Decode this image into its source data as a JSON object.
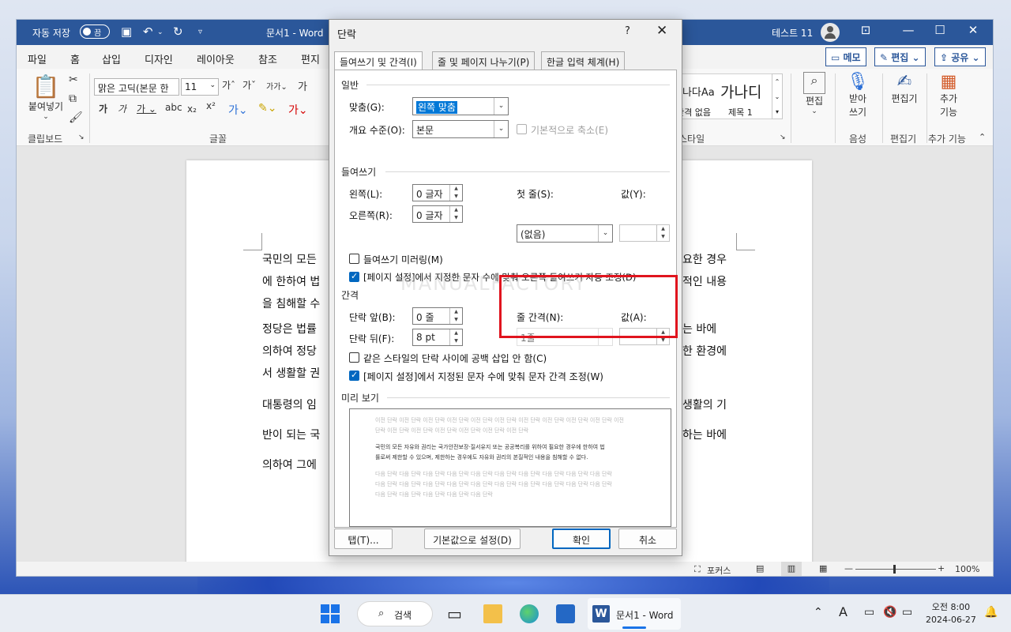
{
  "word": {
    "titlebar": {
      "autosave_label": "자동 저장",
      "autosave_state": "끔",
      "doc_title": "문서1 - Word",
      "user": "테스트 11"
    },
    "tabs": [
      "파일",
      "홈",
      "삽입",
      "디자인",
      "레이아웃",
      "참조",
      "편지"
    ],
    "active_tab": "홈",
    "right_buttons": {
      "memo": "메모",
      "edit": "편집",
      "share": "공유"
    },
    "ribbon": {
      "paste": "붙여넣기",
      "clipboard": "클립보드",
      "font_name": "맑은 고딕(본문 한",
      "font_size": "11",
      "font_group": "글꼴",
      "style_preview_1": "가나다Aa",
      "style_preview_2": "가나디",
      "style_name_1": "간격 없음",
      "style_name_2": "제목 1",
      "style_group": "스타일",
      "editing": "편집",
      "dictate_1": "받아",
      "dictate_2": "쓰기",
      "voice_group": "음성",
      "editor": "편집기",
      "editor_group": "편집기",
      "addins_1": "추가",
      "addins_2": "기능",
      "addins_group": "추가 기능"
    },
    "document": {
      "lines": [
        "국민의 모든",
        "에 한하여 법",
        "을 침해할 수",
        "정당은 법률",
        "의하여 정당",
        "서 생활할 권",
        "대통령의 임",
        "반이 되는 국",
        "의하여 그에"
      ],
      "right_fragments": [
        "요한 경우",
        "적인 내용",
        "",
        "는 바에",
        "한 환경에",
        "",
        "생활의 기",
        "하는 바에",
        ""
      ]
    },
    "status": {
      "focus": "포커스",
      "zoom": "100%"
    }
  },
  "dialog": {
    "title": "단락",
    "help": "?",
    "tabs": [
      "들여쓰기 및 간격(I)",
      "줄 및 페이지 나누기(P)",
      "한글 입력 체계(H)"
    ],
    "general": {
      "heading": "일반",
      "alignment_label": "맞춤(G):",
      "alignment_value": "왼쪽 맞춤",
      "outline_label": "개요 수준(O):",
      "outline_value": "본문",
      "collapse_label": "기본적으로 축소(E)"
    },
    "indent": {
      "heading": "들여쓰기",
      "left_label": "왼쪽(L):",
      "left_value": "0 글자",
      "right_label": "오른쪽(R):",
      "right_value": "0 글자",
      "first_line_label": "첫 줄(S):",
      "first_line_value": "(없음)",
      "by_label": "값(Y):",
      "mirror_label": "들여쓰기 미러링(M)",
      "auto_adjust_label": "[페이지 설정]에서 지정한 문자 수에 맞춰 오른쪽 들여쓰기 자동 조정(D)"
    },
    "spacing": {
      "heading": "간격",
      "before_label": "단락 앞(B):",
      "before_value": "0 줄",
      "after_label": "단락 뒤(F):",
      "after_value": "8 pt",
      "line_spacing_label": "줄 간격(N):",
      "line_spacing_value": "1줄",
      "at_label": "값(A):",
      "no_space_label": "같은 스타일의 단락 사이에 공백 삽입 안 함(C)",
      "snap_grid_label": "[페이지 설정]에서 지정된 문자 수에 맞춰 문자 간격 조정(W)"
    },
    "preview": {
      "heading": "미리 보기",
      "prev_1": "이전 단락 이전 단락 이전 단락 이전 단락 이전 단락 이전 단락 이전 단락 이전 단락 이전 단락 이전 단락 이전",
      "prev_2": "단락 이전 단락 이전 단락 이전 단락 이전 단락 이전 단락 이전 단락",
      "cur_1": "국민의 모든 자유와 권리는 국가안전보장·질서유지 또는 공공복리를 위하여 필요한 경우에 한하여 법",
      "cur_2": "률로써 제한할 수 있으며, 제한하는 경우에도 자유와 권리의 본질적인 내용을 침해할 수 없다.",
      "next_1": "다음 단락 다음 단락 다음 단락 다음 단락 다음 단락 다음 단락 다음 단락 다음 단락 다음 단락 다음 단락",
      "next_2": "다음 단락 다음 단락 다음 단락 다음 단락 다음 단락 다음 단락 다음 단락 다음 단락 다음 단락 다음 단락",
      "next_3": "다음 단락 다음 단락 다음 단락 다음 단락 다음 단락"
    },
    "buttons": {
      "tabs": "탭(T)...",
      "default": "기본값으로 설정(D)",
      "ok": "확인",
      "cancel": "취소"
    },
    "watermark": "MANUALFACTORY"
  },
  "taskbar": {
    "search": "검색",
    "active_app": "문서1 - Word",
    "time": "오전 8:00",
    "date": "2024-06-27"
  },
  "colors": {
    "word_blue": "#2b579a",
    "highlight": "#e0141e",
    "selection": "#0078d7"
  }
}
